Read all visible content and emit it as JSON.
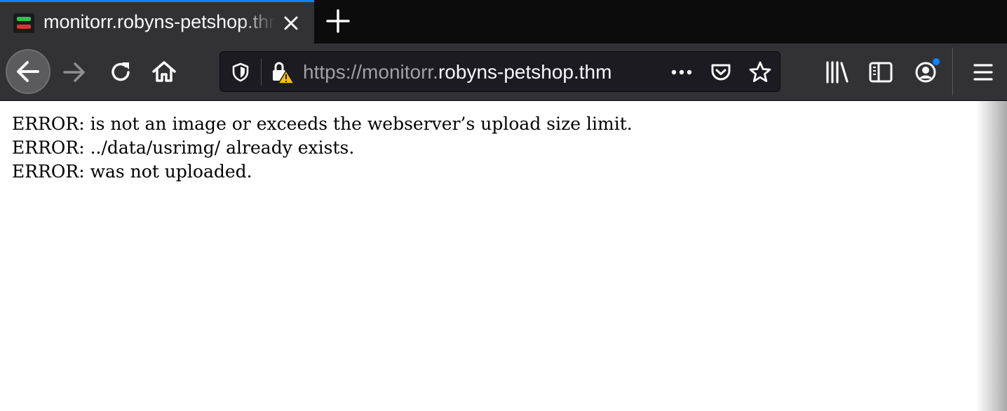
{
  "browser": {
    "tab": {
      "title": "monitorr.robyns-petshop.thm",
      "favicon": "monitorr-icon"
    },
    "address_bar": {
      "url_prefix": "https://monitorr.",
      "url_host": "robyns-petshop.thm"
    },
    "colors": {
      "accent": "#0a84ff",
      "toolbar": "#323234",
      "tabstrip": "#0c0c0d",
      "warning": "#ffbf00",
      "notification_dot": "#0a84ff"
    }
  },
  "page": {
    "messages": [
      "ERROR: is not an image or exceeds the webserver’s upload size limit.",
      "ERROR: ../data/usrimg/ already exists.",
      "ERROR: was not uploaded."
    ]
  }
}
